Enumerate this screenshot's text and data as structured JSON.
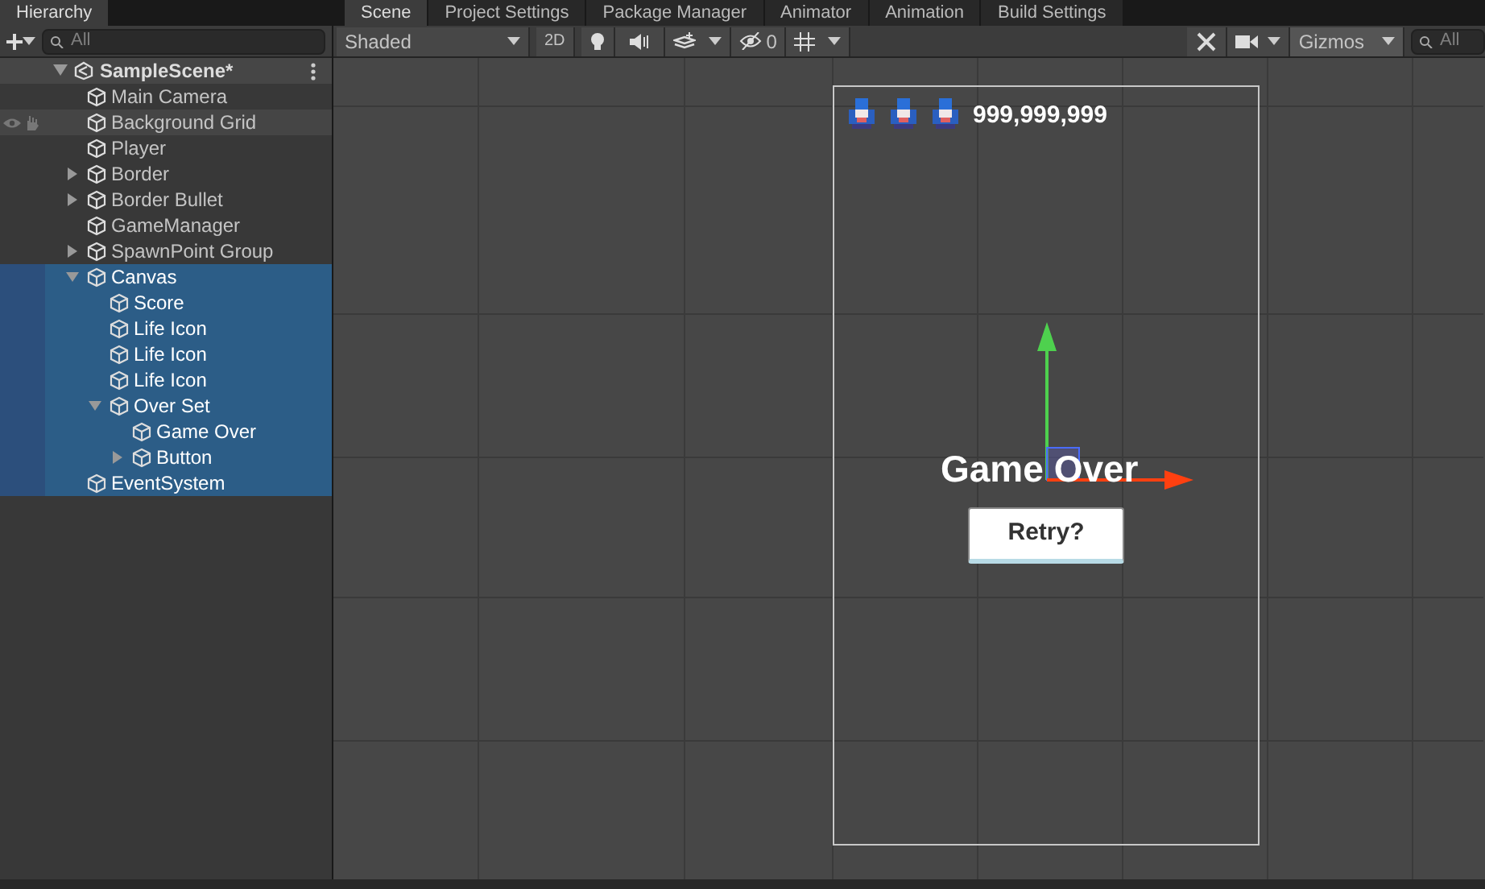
{
  "hierarchy_tabs": [
    {
      "label": "Hierarchy",
      "selected": true
    }
  ],
  "scene_tabs": [
    {
      "label": "Scene",
      "selected": true
    },
    {
      "label": "Project Settings",
      "selected": false
    },
    {
      "label": "Package Manager",
      "selected": false
    },
    {
      "label": "Animator",
      "selected": false
    },
    {
      "label": "Animation",
      "selected": false
    },
    {
      "label": "Build Settings",
      "selected": false
    }
  ],
  "hierarchy": {
    "search_placeholder": "All",
    "scene": {
      "label": "SampleScene*",
      "expanded": true
    },
    "items": [
      {
        "label": "Main Camera",
        "selected": false,
        "hovered": false
      },
      {
        "label": "Background Grid",
        "selected": false,
        "hovered": true
      },
      {
        "label": "Player",
        "selected": false,
        "hovered": false
      },
      {
        "label": "Border",
        "selected": false,
        "hovered": false,
        "expanded": false
      },
      {
        "label": "Border Bullet",
        "selected": false,
        "hovered": false,
        "expanded": false
      },
      {
        "label": "GameManager",
        "selected": false,
        "hovered": false
      },
      {
        "label": "SpawnPoint Group",
        "selected": false,
        "hovered": false,
        "expanded": false
      },
      {
        "label": "Canvas",
        "selected": true,
        "hovered": false,
        "expanded": true,
        "children": [
          {
            "label": "Score",
            "selected": true,
            "hovered": false
          },
          {
            "label": "Life Icon",
            "selected": true,
            "hovered": false
          },
          {
            "label": "Life Icon",
            "selected": true,
            "hovered": false
          },
          {
            "label": "Life Icon",
            "selected": true,
            "hovered": false
          },
          {
            "label": "Over Set",
            "selected": true,
            "hovered": false,
            "expanded": true,
            "children": [
              {
                "label": "Game Over",
                "selected": true,
                "hovered": false
              },
              {
                "label": "Button",
                "selected": true,
                "hovered": false,
                "expanded": false
              }
            ]
          }
        ]
      },
      {
        "label": "EventSystem",
        "selected": true,
        "hovered": false
      }
    ]
  },
  "scene_toolbar": {
    "shading": "Shaded",
    "mode_2d": {
      "label": "2D",
      "on": false
    },
    "hidden_count": "0",
    "gizmos": "Gizmos",
    "search_placeholder": "All"
  },
  "game_view": {
    "life_icons": [
      {
        "kind": "ship"
      },
      {
        "kind": "ship"
      },
      {
        "kind": "ship"
      }
    ],
    "score": "999,999,999",
    "title": "Game Over",
    "retry_button": "Retry?"
  }
}
